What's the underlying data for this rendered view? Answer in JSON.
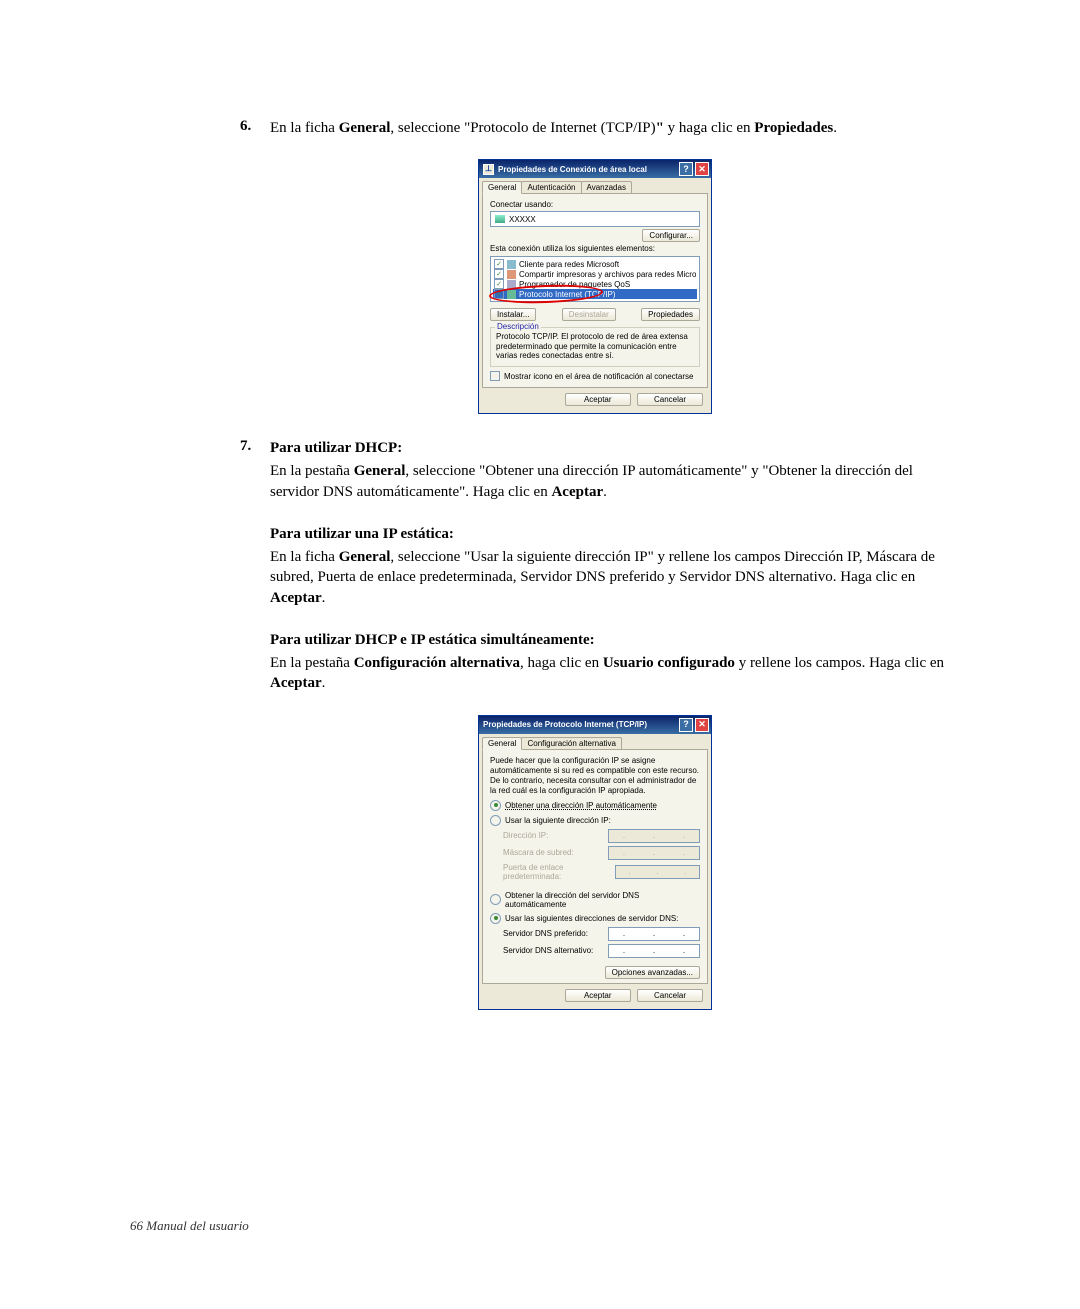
{
  "step6": {
    "num": "6.",
    "pre": "En la ficha ",
    "bold1": "General",
    "mid": ", seleccione \"Protocolo de Internet (TCP/IP)",
    "bold2": "\"",
    "mid2": " y haga clic en ",
    "bold3": "Propiedades",
    "post": "."
  },
  "dialog1": {
    "title": "Propiedades de Conexión de área local",
    "tabs": {
      "general": "General",
      "auth": "Autenticación",
      "advanced": "Avanzadas"
    },
    "connectUsing": "Conectar usando:",
    "adapter": "XXXXX",
    "configureBtn": "Configurar...",
    "usesElements": "Esta conexión utiliza los siguientes elementos:",
    "items": {
      "i1": "Cliente para redes Microsoft",
      "i2": "Compartir impresoras y archivos para redes Microsoft",
      "i3": "Programador de paquetes QoS",
      "i4": "Protocolo Internet (TCP/IP)"
    },
    "installBtn": "Instalar...",
    "uninstallBtn": "Desinstalar",
    "propsBtn": "Propiedades",
    "descTitle": "Descripción",
    "descBody": "Protocolo TCP/IP. El protocolo de red de área extensa predeterminado que permite la comunicación entre varias redes conectadas entre sí.",
    "showIcon": "Mostrar icono en el área de notificación al conectarse",
    "accept": "Aceptar",
    "cancel": "Cancelar"
  },
  "step7": {
    "num": "7.",
    "h1": "Para utilizar DHCP:",
    "p1a": "En la pestaña ",
    "p1b": "General",
    "p1c": ", seleccione \"Obtener una dirección IP automáticamente\" y \"Obtener la dirección del servidor DNS automáticamente\". Haga clic en ",
    "p1d": "Aceptar",
    "p1e": ".",
    "h2": "Para utilizar una IP estática:",
    "p2a": "En la ficha ",
    "p2b": "General",
    "p2c": ", seleccione \"Usar la siguiente dirección IP\" y rellene los campos Dirección IP, Máscara de subred, Puerta de enlace predeterminada, Servidor DNS preferido y Servidor DNS alternativo. Haga clic en ",
    "p2d": "Aceptar",
    "p2e": ".",
    "h3": "Para utilizar DHCP e IP estática simultáneamente:",
    "p3a": "En la pestaña ",
    "p3b": "Configuración alternativa",
    "p3c": ", haga clic en ",
    "p3d": "Usuario configurado",
    "p3e": " y rellene los campos. Haga clic en ",
    "p3f": "Aceptar",
    "p3g": "."
  },
  "dialog2": {
    "title": "Propiedades de Protocolo Internet (TCP/IP)",
    "tabs": {
      "general": "General",
      "alt": "Configuración alternativa"
    },
    "info": "Puede hacer que la configuración IP se asigne automáticamente si su red es compatible con este recurso. De lo contrario, necesita consultar con el administrador de la red cuál es la configuración IP apropiada.",
    "r1": "Obtener una dirección IP automáticamente",
    "r2": "Usar la siguiente dirección IP:",
    "ipLabel": "Dirección IP:",
    "maskLabel": "Máscara de subred:",
    "gwLabel": "Puerta de enlace predeterminada:",
    "r3": "Obtener la dirección del servidor DNS automáticamente",
    "r4": "Usar las siguientes direcciones de servidor DNS:",
    "dns1": "Servidor DNS preferido:",
    "dns2": "Servidor DNS alternativo:",
    "advBtn": "Opciones avanzadas...",
    "accept": "Aceptar",
    "cancel": "Cancelar"
  },
  "footer": {
    "pageNum": "66",
    "bookTitle": " Manual del usuario"
  }
}
